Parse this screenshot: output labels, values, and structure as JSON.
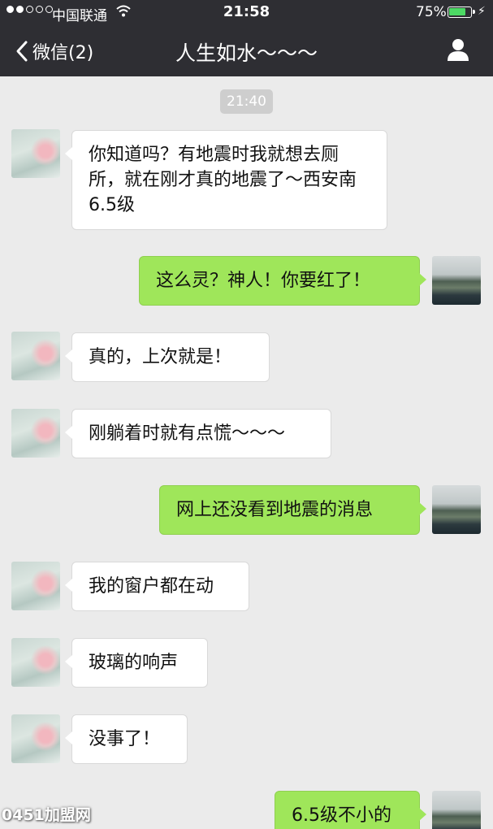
{
  "status_bar": {
    "carrier": "中国联通",
    "time": "21:58",
    "battery_percent": "75%",
    "signal_bars_filled": 2,
    "signal_bars_total": 5,
    "battery_color": "#4cd964"
  },
  "nav": {
    "back_label": "微信(2)",
    "title": "人生如水～～～",
    "back_icon": "chevron-left-icon",
    "profile_icon": "person-icon"
  },
  "chat": {
    "timestamp": "21:40",
    "messages": [
      {
        "side": "them",
        "text": "你知道吗？有地震时我就想去厕所，就在刚才真的地震了～西安南6.5级"
      },
      {
        "side": "me",
        "text": "这么灵？神人！你要红了！"
      },
      {
        "side": "them",
        "text": "真的，上次就是！"
      },
      {
        "side": "them",
        "text": "刚躺着时就有点慌～～～"
      },
      {
        "side": "me",
        "text": "网上还没看到地震的消息"
      },
      {
        "side": "them",
        "text": "我的窗户都在动"
      },
      {
        "side": "them",
        "text": "玻璃的响声"
      },
      {
        "side": "them",
        "text": "没事了！"
      },
      {
        "side": "me",
        "text": "6.5级不小的"
      }
    ]
  },
  "watermark": "0451加盟网",
  "colors": {
    "nav_bg": "#2e2e33",
    "chat_bg": "#ebebeb",
    "my_bubble": "#9fe65a",
    "their_bubble": "#ffffff"
  }
}
